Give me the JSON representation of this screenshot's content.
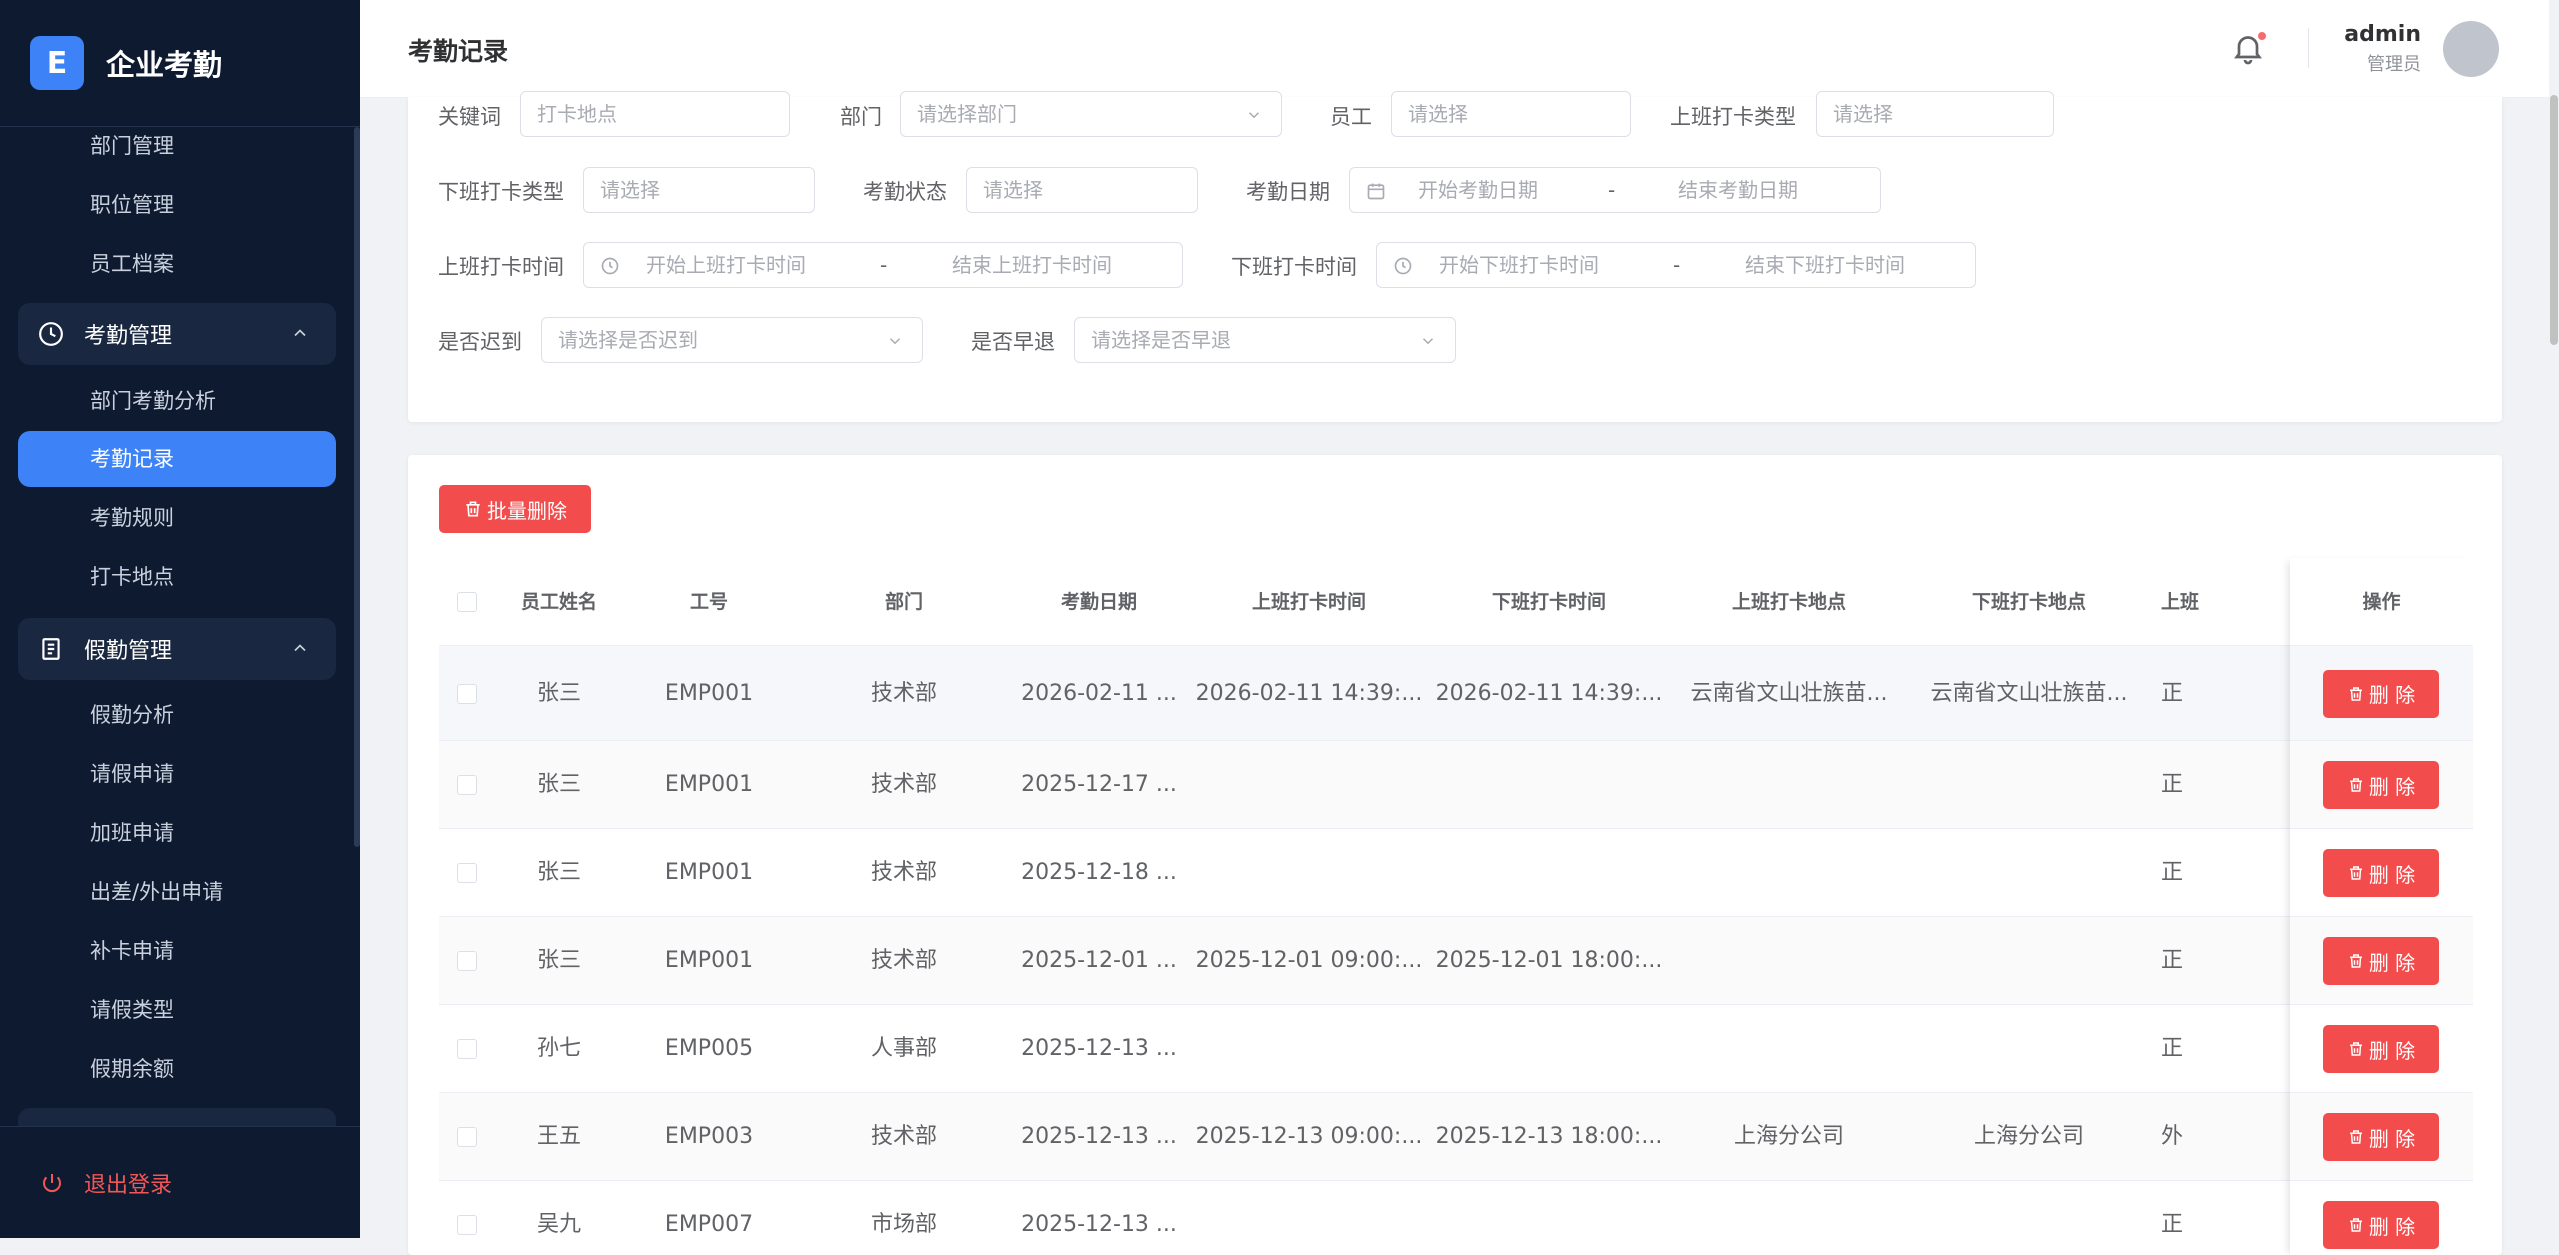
{
  "app": {
    "logo_letter": "E",
    "name": "企业考勤"
  },
  "sidebar": {
    "items_top": [
      "部门管理",
      "职位管理",
      "员工档案"
    ],
    "groups": [
      {
        "label": "考勤管理",
        "icon": "clock-icon",
        "children": [
          "部门考勤分析",
          "考勤记录",
          "考勤规则",
          "打卡地点"
        ],
        "active": "考勤记录"
      },
      {
        "label": "假勤管理",
        "icon": "document-icon",
        "children": [
          "假勤分析",
          "请假申请",
          "加班申请",
          "出差/外出申请",
          "补卡申请",
          "请假类型",
          "假期余额"
        ]
      }
    ],
    "logout": "退出登录"
  },
  "header": {
    "title": "考勤记录",
    "user_name": "admin",
    "user_role": "管理员"
  },
  "filters": {
    "keyword": {
      "label": "关键词",
      "placeholder": "打卡地点"
    },
    "department": {
      "label": "部门",
      "placeholder": "请选择部门"
    },
    "employee": {
      "label": "员工",
      "placeholder": "请选择"
    },
    "checkin_type": {
      "label": "上班打卡类型",
      "placeholder": "请选择"
    },
    "checkout_type": {
      "label": "下班打卡类型",
      "placeholder": "请选择"
    },
    "status": {
      "label": "考勤状态",
      "placeholder": "请选择"
    },
    "date": {
      "label": "考勤日期",
      "start": "开始考勤日期",
      "sep": "-",
      "end": "结束考勤日期"
    },
    "checkin_time": {
      "label": "上班打卡时间",
      "start": "开始上班打卡时间",
      "sep": "-",
      "end": "结束上班打卡时间"
    },
    "checkout_time": {
      "label": "下班打卡时间",
      "start": "开始下班打卡时间",
      "sep": "-",
      "end": "结束下班打卡时间"
    },
    "late": {
      "label": "是否迟到",
      "placeholder": "请选择是否迟到"
    },
    "early": {
      "label": "是否早退",
      "placeholder": "请选择是否早退"
    }
  },
  "table": {
    "batch_delete": "批量删除",
    "columns": [
      "员工姓名",
      "工号",
      "部门",
      "考勤日期",
      "上班打卡时间",
      "下班打卡时间",
      "上班打卡地点",
      "下班打卡地点",
      "上班"
    ],
    "op_column": "操作",
    "delete_label": "删 除",
    "rows": [
      [
        "张三",
        "EMP001",
        "技术部",
        "2026-02-11 ...",
        "2026-02-11 14:39:...",
        "2026-02-11 14:39:...",
        "云南省文山壮族苗...",
        "云南省文山壮族苗...",
        "正"
      ],
      [
        "张三",
        "EMP001",
        "技术部",
        "2025-12-17 ...",
        "",
        "",
        "",
        "",
        "正"
      ],
      [
        "张三",
        "EMP001",
        "技术部",
        "2025-12-18 ...",
        "",
        "",
        "",
        "",
        "正"
      ],
      [
        "张三",
        "EMP001",
        "技术部",
        "2025-12-01 ...",
        "2025-12-01 09:00:...",
        "2025-12-01 18:00:...",
        "",
        "",
        "正"
      ],
      [
        "孙七",
        "EMP005",
        "人事部",
        "2025-12-13 ...",
        "",
        "",
        "",
        "",
        "正"
      ],
      [
        "王五",
        "EMP003",
        "技术部",
        "2025-12-13 ...",
        "2025-12-13 09:00:...",
        "2025-12-13 18:00:...",
        "上海分公司",
        "上海分公司",
        "外"
      ],
      [
        "吴九",
        "EMP007",
        "市场部",
        "2025-12-13 ...",
        "",
        "",
        "",
        "",
        "正"
      ]
    ]
  }
}
